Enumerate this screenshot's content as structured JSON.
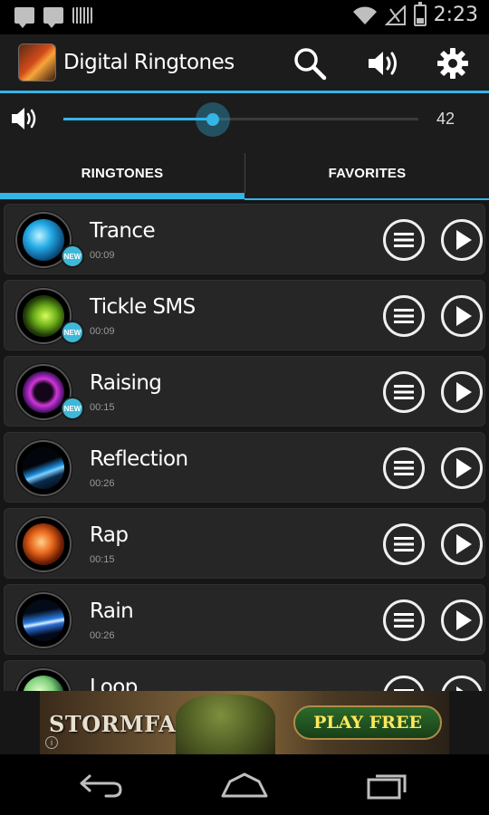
{
  "status_bar": {
    "time": "2:23",
    "icons": [
      "chat-bubble-icon",
      "chat-bubble-icon",
      "barcode-icon",
      "wifi-icon",
      "cell-signal-icon",
      "battery-icon"
    ]
  },
  "app_bar": {
    "title": "Digital Ringtones",
    "actions": [
      "search-icon",
      "volume-icon",
      "settings-icon"
    ],
    "accent_color": "#33b5e5"
  },
  "volume": {
    "value": "42",
    "fraction": 0.42
  },
  "tabs": [
    {
      "label": "RINGTONES",
      "selected": true
    },
    {
      "label": "FAVORITES",
      "selected": false
    }
  ],
  "ringtones": [
    {
      "name": "Trance",
      "duration": "00:09",
      "badge": "NEW"
    },
    {
      "name": "Tickle SMS",
      "duration": "00:09",
      "badge": "NEW"
    },
    {
      "name": "Raising",
      "duration": "00:15",
      "badge": "NEW"
    },
    {
      "name": "Reflection",
      "duration": "00:26",
      "badge": ""
    },
    {
      "name": "Rap",
      "duration": "00:15",
      "badge": ""
    },
    {
      "name": "Rain",
      "duration": "00:26",
      "badge": ""
    },
    {
      "name": "Loop",
      "duration": "",
      "badge": ""
    }
  ],
  "ad": {
    "brand": "STORMFALL",
    "cta": "PLAY FREE",
    "info": "i"
  },
  "nav": [
    "back-icon",
    "home-icon",
    "recents-icon"
  ]
}
